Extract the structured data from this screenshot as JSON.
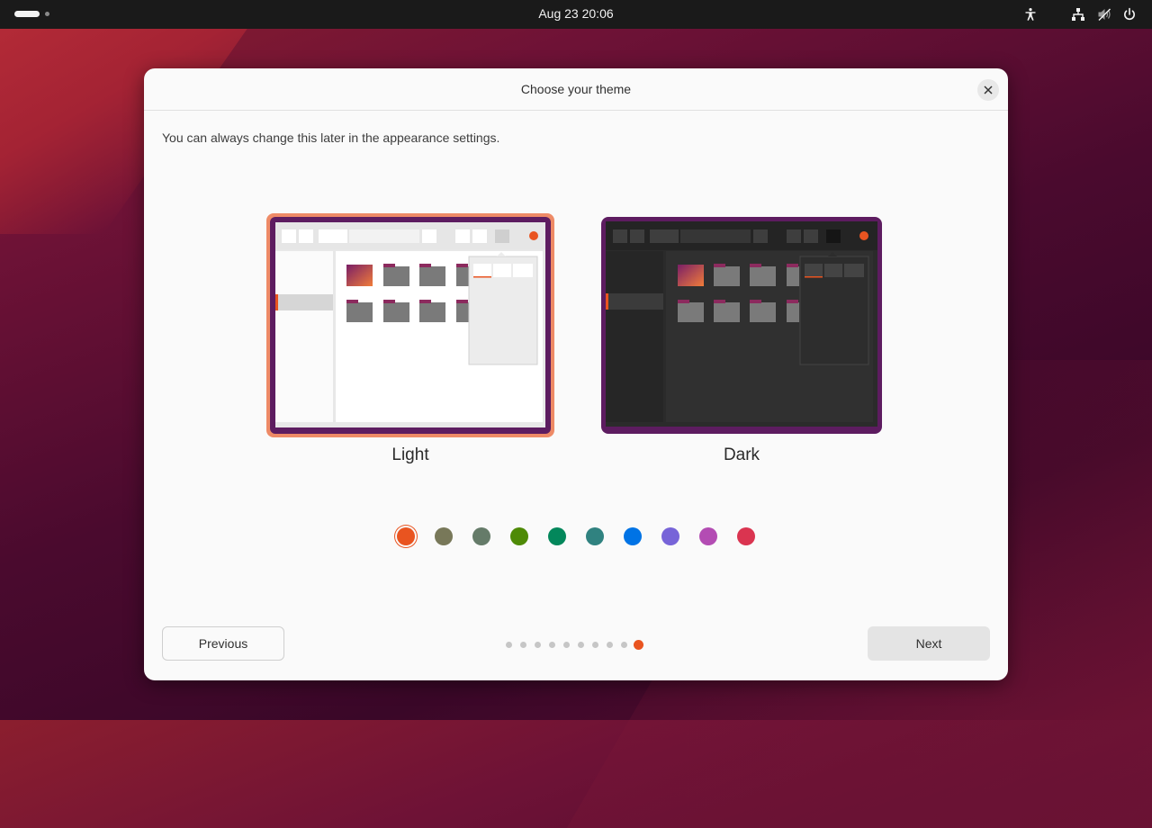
{
  "topbar": {
    "clock": "Aug 23  20:06",
    "icons": [
      "workspace-indicator",
      "accessibility-icon",
      "network-icon",
      "volume-muted-icon",
      "power-icon"
    ]
  },
  "dialog": {
    "title": "Choose your theme",
    "subtitle": "You can always change this later in the appearance settings.",
    "themes": [
      {
        "label": "Light",
        "selected": true
      },
      {
        "label": "Dark",
        "selected": false
      }
    ],
    "accent_colors": [
      "#e95420",
      "#787859",
      "#657b69",
      "#4e8a06",
      "#03875b",
      "#308280",
      "#0073e5",
      "#7764d8",
      "#b34cb3",
      "#da3450"
    ],
    "selected_accent": "#e95420",
    "pager": {
      "total": 10,
      "current": 10
    },
    "previous_label": "Previous",
    "next_label": "Next"
  }
}
